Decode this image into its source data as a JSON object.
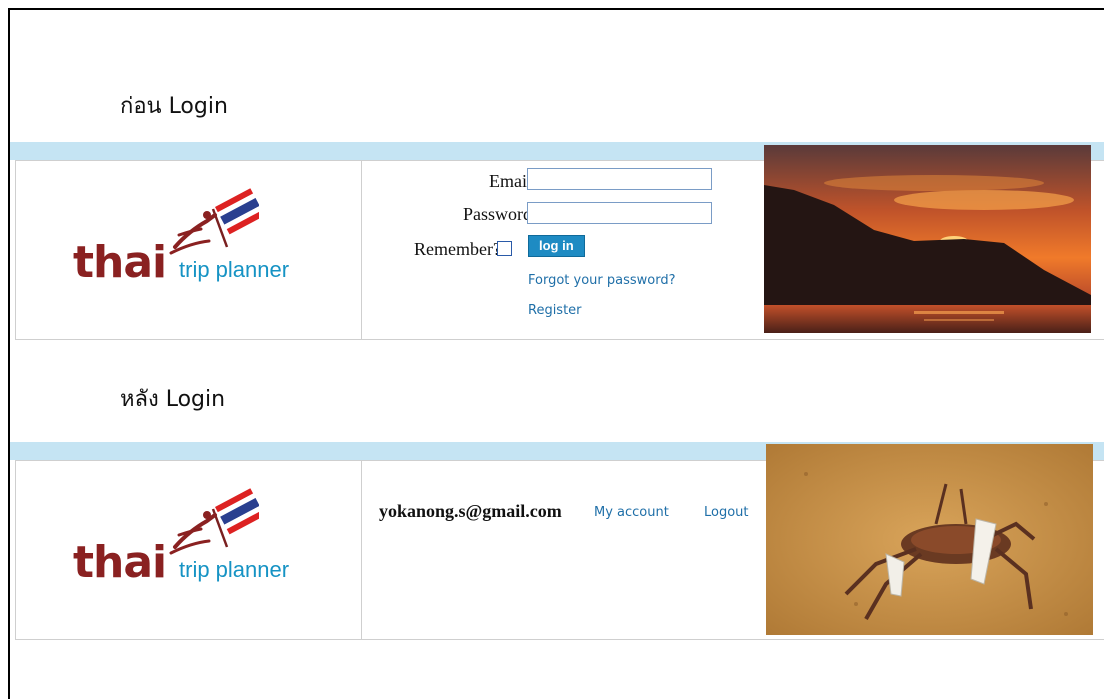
{
  "before": {
    "caption": "ก่อน Login",
    "logo": {
      "word": "thai",
      "tagline": "trip planner"
    },
    "form": {
      "email_label": "Email",
      "password_label": "Password",
      "remember_label": "Remember?",
      "login_button": "log in",
      "forgot_link": "Forgot your password?",
      "register_link": "Register"
    },
    "photo_icon": "sunset-mountain-photo"
  },
  "after": {
    "caption": "หลัง Login",
    "logo": {
      "word": "thai",
      "tagline": "trip planner"
    },
    "user_email": "yokanong.s@gmail.com",
    "my_account_link": "My account",
    "logout_link": "Logout",
    "photo_icon": "crab-on-sand-photo"
  },
  "colors": {
    "strip": "#c5e4f3",
    "logo_red": "#8a2121",
    "logo_blue": "#1693c4",
    "button": "#1e8bc3",
    "link": "#1f6fa8"
  }
}
